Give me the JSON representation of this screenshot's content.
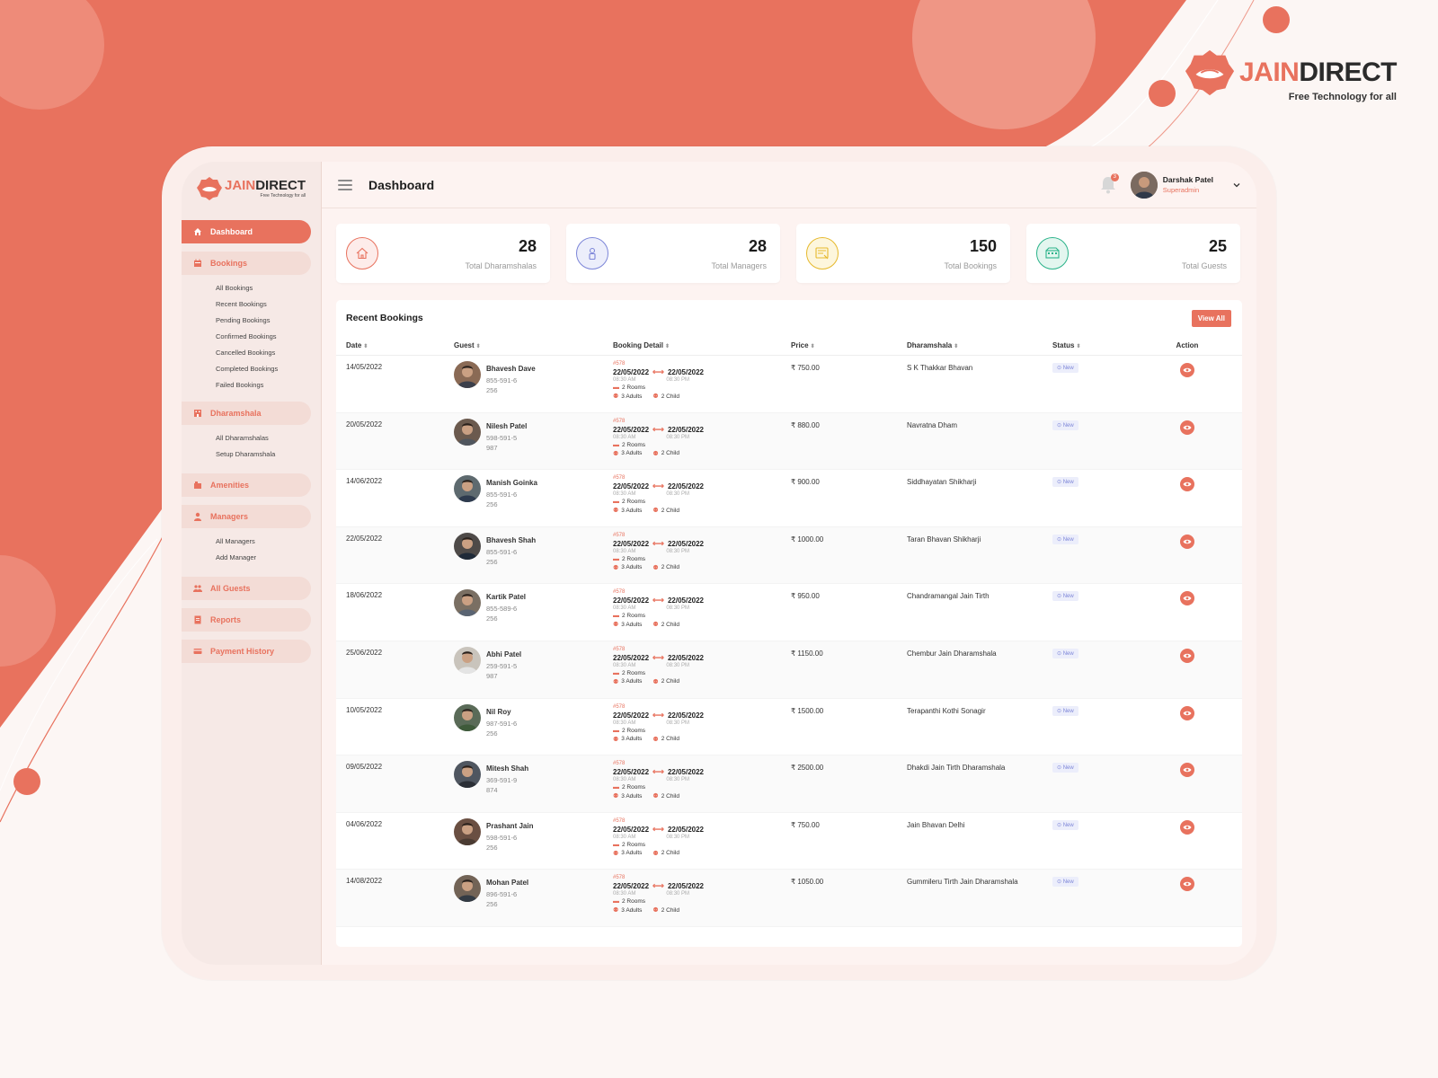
{
  "brand": {
    "name_part1": "JAIN",
    "name_part2": "DIRECT",
    "tagline": "Free Technology for all"
  },
  "sidebar": {
    "items": [
      {
        "label": "Dashboard",
        "icon": "home-icon",
        "active": true
      },
      {
        "label": "Bookings",
        "icon": "calendar-icon",
        "children": [
          "All Bookings",
          "Recent Bookings",
          "Pending Bookings",
          "Confirmed Bookings",
          "Cancelled Bookings",
          "Completed Bookings",
          "Failed  Bookings"
        ]
      },
      {
        "label": "Dharamshala",
        "icon": "building-icon",
        "children": [
          "All Dharamshalas",
          "Setup Dharamshala"
        ]
      },
      {
        "label": "Amenities",
        "icon": "amenities-icon"
      },
      {
        "label": "Managers",
        "icon": "user-icon",
        "children": [
          "All Managers",
          "Add Manager"
        ]
      },
      {
        "label": "All Guests",
        "icon": "users-icon"
      },
      {
        "label": "Reports",
        "icon": "report-icon"
      },
      {
        "label": "Payment History",
        "icon": "payment-icon"
      }
    ]
  },
  "header": {
    "title": "Dashboard",
    "notifications_count": "3",
    "user_name": "Darshak Patel",
    "user_role": "Superadmin"
  },
  "stats": [
    {
      "value": "28",
      "label": "Total Dharamshalas",
      "icon": "home-icon",
      "color": "#e8725e"
    },
    {
      "value": "28",
      "label": "Total Managers",
      "icon": "manager-icon",
      "color": "#7d86d8"
    },
    {
      "value": "150",
      "label": "Total Bookings",
      "icon": "booking-icon",
      "color": "#e6b92d"
    },
    {
      "value": "25",
      "label": "Total Guests",
      "icon": "guests-icon",
      "color": "#2bb38a"
    }
  ],
  "recent": {
    "title": "Recent Bookings",
    "view_all": "View All",
    "columns": [
      "Date",
      "Guest",
      "Booking Detail",
      "Price",
      "Dharamshala",
      "Status",
      "Action"
    ],
    "rows": [
      {
        "date": "14/05/2022",
        "name": "Bhavesh Dave",
        "phone1": "855-591-6",
        "phone2": "256",
        "price": "₹ 750.00",
        "dharamshala": "S K Thakkar Bhavan"
      },
      {
        "date": "20/05/2022",
        "name": "Nilesh Patel",
        "phone1": "598-591-5",
        "phone2": "987",
        "price": "₹ 880.00",
        "dharamshala": "Navratna Dham"
      },
      {
        "date": "14/06/2022",
        "name": "Manish Goinka",
        "phone1": "855-591-6",
        "phone2": "256",
        "price": "₹ 900.00",
        "dharamshala": "Siddhayatan Shikharji"
      },
      {
        "date": "22/05/2022",
        "name": "Bhavesh Shah",
        "phone1": "855-591-6",
        "phone2": "256",
        "price": "₹ 1000.00",
        "dharamshala": "Taran Bhavan Shikharji"
      },
      {
        "date": "18/06/2022",
        "name": "Kartik Patel",
        "phone1": "855-589-6",
        "phone2": "256",
        "price": "₹ 950.00",
        "dharamshala": "Chandramangal Jain Tirth"
      },
      {
        "date": "25/06/2022",
        "name": "Abhi Patel",
        "phone1": "259-591-5",
        "phone2": "987",
        "price": "₹ 1150.00",
        "dharamshala": "Chembur Jain Dharamshala"
      },
      {
        "date": "10/05/2022",
        "name": "Nil Roy",
        "phone1": "987-591-6",
        "phone2": "256",
        "price": "₹ 1500.00",
        "dharamshala": "Terapanthi Kothi Sonagir"
      },
      {
        "date": "09/05/2022",
        "name": "Mitesh Shah",
        "phone1": "369-591-9",
        "phone2": "874",
        "price": "₹ 2500.00",
        "dharamshala": "Dhakdi Jain Tirth Dharamshala"
      },
      {
        "date": "04/06/2022",
        "name": "Prashant Jain",
        "phone1": "598-591-6",
        "phone2": "256",
        "price": "₹ 750.00",
        "dharamshala": "Jain Bhavan Delhi"
      },
      {
        "date": "14/08/2022",
        "name": "Mohan Patel",
        "phone1": "896-591-6",
        "phone2": "256",
        "price": "₹ 1050.00",
        "dharamshala": "Gummileru Tirth Jain Dharamshala"
      }
    ],
    "detail": {
      "booking_id": "#578",
      "check_in": "22/05/2022",
      "check_out": "22/05/2022",
      "check_in_time": "08:30 AM",
      "check_out_time": "08:30 PM",
      "rooms": "2 Rooms",
      "adults": "3 Adults",
      "children": "2 Child",
      "status": "New"
    }
  },
  "colors": {
    "accent": "#e8725e",
    "status_bg": "#eceefb",
    "status_text": "#7d86d8"
  }
}
